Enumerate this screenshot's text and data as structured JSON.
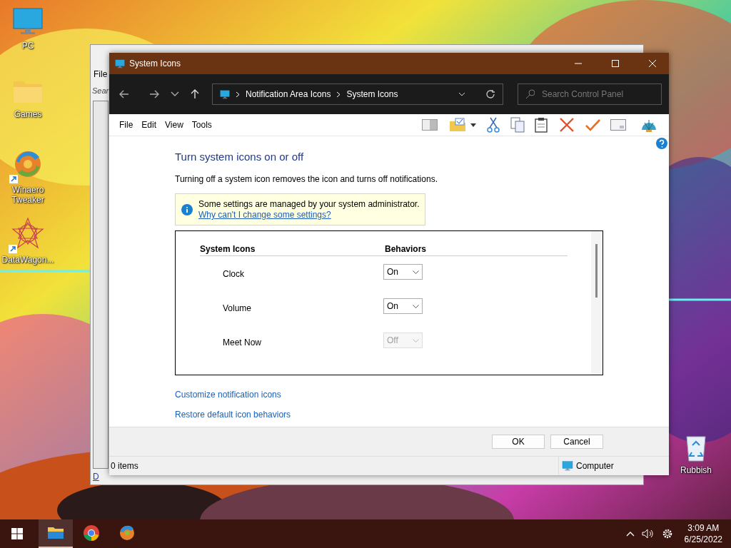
{
  "desktop": {
    "icons": [
      {
        "kind": "monitor",
        "label": "PC",
        "shortcut": false
      },
      {
        "kind": "folder",
        "label": "Games",
        "shortcut": false
      },
      {
        "kind": "swirl",
        "label": "Winaero Tweaker",
        "shortcut": true
      },
      {
        "kind": "star",
        "label": "DataWagon...",
        "shortcut": true
      }
    ],
    "recycle_bin": {
      "label": "Rubbish"
    }
  },
  "back_window": {
    "menu": "File",
    "search": "Sear",
    "link": "D"
  },
  "window": {
    "title": "System Icons",
    "address": [
      "Notification Area Icons",
      "System Icons"
    ],
    "search": {
      "placeholder": "Search Control Panel"
    },
    "menu": [
      "File",
      "Edit",
      "View",
      "Tools"
    ],
    "heading": "Turn system icons on or off",
    "description": "Turning off a system icon removes the icon and turns off notifications.",
    "info": {
      "text": "Some settings are managed by your system administrator.",
      "link": "Why can't I change some settings?"
    },
    "table": {
      "columns": [
        "System Icons",
        "Behaviors"
      ],
      "rows": [
        {
          "name": "Clock",
          "value": "On",
          "disabled": false
        },
        {
          "name": "Volume",
          "value": "On",
          "disabled": false
        },
        {
          "name": "Meet Now",
          "value": "Off",
          "disabled": true
        }
      ]
    },
    "links": [
      "Customize notification icons",
      "Restore default icon behaviors"
    ],
    "buttons": [
      "OK",
      "Cancel"
    ],
    "status_bar": {
      "items": "0 items",
      "zone": "Computer"
    }
  },
  "taskbar": {
    "apps": [
      {
        "kind": "explorer",
        "selected": true
      },
      {
        "kind": "chrome",
        "selected": false
      },
      {
        "kind": "swirl",
        "selected": false
      }
    ],
    "time": "3:09 AM",
    "date": "6/25/2022"
  }
}
